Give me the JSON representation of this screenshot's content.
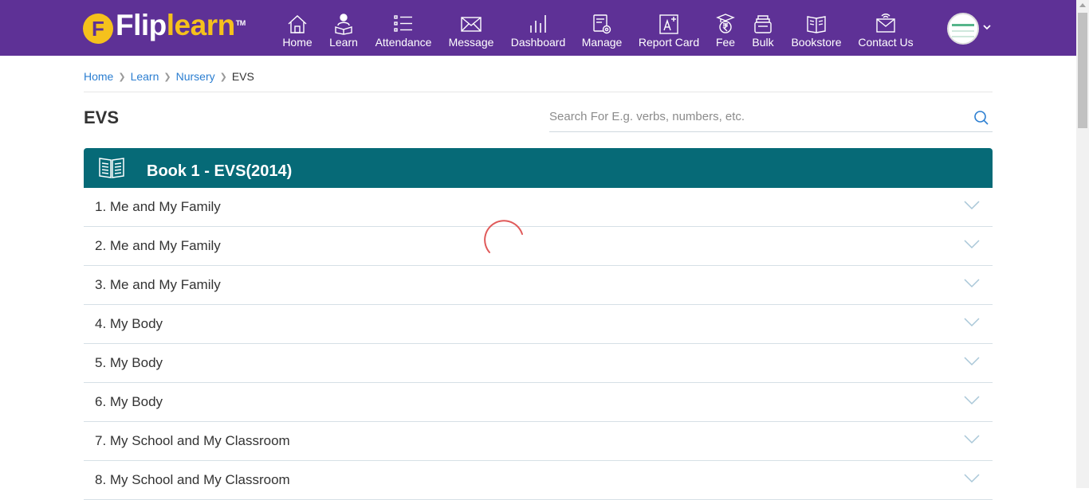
{
  "brand": {
    "name_part1": "Flip",
    "name_part2": "learn",
    "mark": "F",
    "tm": "TM"
  },
  "nav": [
    {
      "label": "Home",
      "icon": "home-icon"
    },
    {
      "label": "Learn",
      "icon": "learn-icon"
    },
    {
      "label": "Attendance",
      "icon": "attendance-icon"
    },
    {
      "label": "Message",
      "icon": "message-icon"
    },
    {
      "label": "Dashboard",
      "icon": "dashboard-icon"
    },
    {
      "label": "Manage",
      "icon": "manage-icon"
    },
    {
      "label": "Report Card",
      "icon": "report-card-icon"
    },
    {
      "label": "Fee",
      "icon": "fee-icon"
    },
    {
      "label": "Bulk",
      "icon": "bulk-icon"
    },
    {
      "label": "Bookstore",
      "icon": "bookstore-icon"
    },
    {
      "label": "Contact Us",
      "icon": "contact-us-icon"
    }
  ],
  "breadcrumb": {
    "home": "Home",
    "learn": "Learn",
    "grade": "Nursery",
    "current": "EVS"
  },
  "page_title": "EVS",
  "search": {
    "placeholder": "Search For E.g. verbs, numbers, etc."
  },
  "book": {
    "title": "Book 1 - EVS(2014)"
  },
  "chapters": [
    "1. Me and My Family",
    "2. Me and My Family",
    "3. Me and My Family",
    "4. My Body",
    "5. My Body",
    "6. My Body",
    "7. My School and My Classroom",
    "8. My School and My Classroom"
  ],
  "colors": {
    "nav_bg": "#5e3196",
    "brand_yellow": "#f5c11c",
    "book_header": "#066a77",
    "link": "#2b7ed1",
    "spinner": "#e05a5a"
  }
}
